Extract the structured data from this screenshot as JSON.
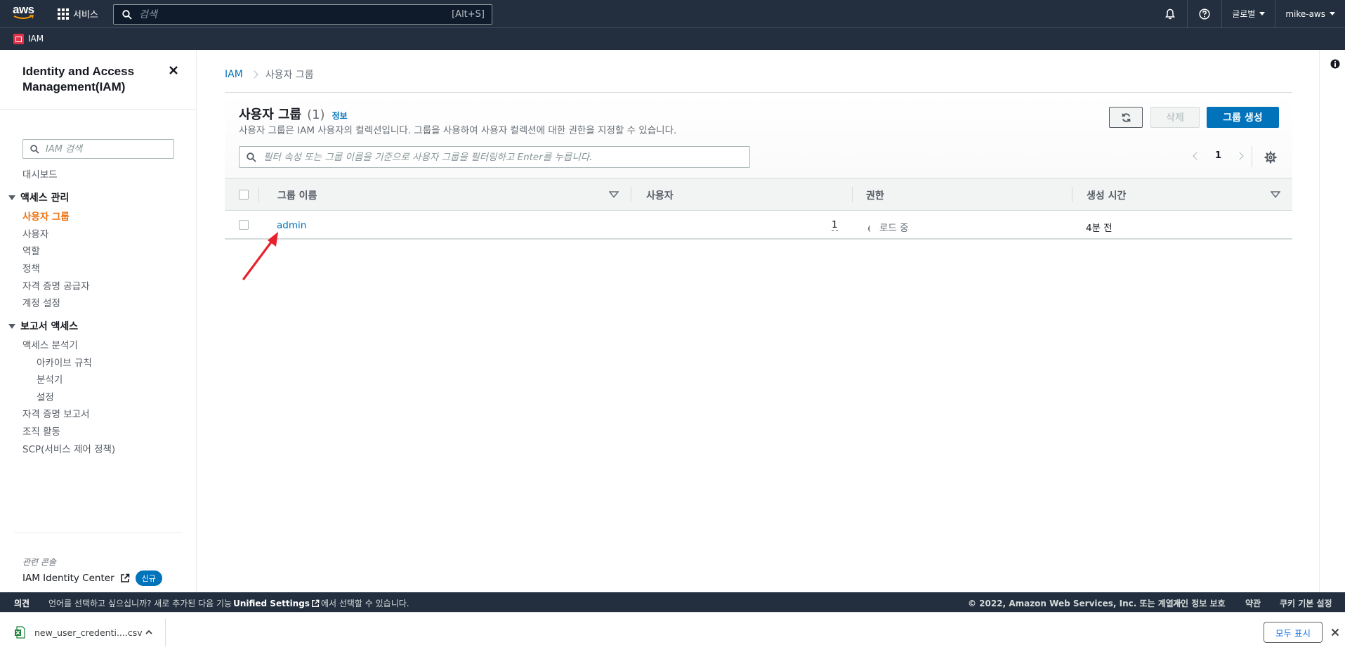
{
  "topnav": {
    "logo_text": "aws",
    "services_label": "서비스",
    "search_placeholder": "검색",
    "search_shortcut": "[Alt+S]",
    "region_label": "글로벌",
    "account_label": "mike-aws",
    "icons": [
      "bell-icon",
      "help-icon"
    ]
  },
  "subnav": {
    "service_name": "IAM"
  },
  "sidebar": {
    "title": "Identity and Access Management(IAM)",
    "search_placeholder": "IAM 검색",
    "dashboard": "대시보드",
    "sections": [
      {
        "label": "액세스 관리",
        "items": [
          "사용자 그룹",
          "사용자",
          "역할",
          "정책",
          "자격 증명 공급자",
          "계정 설정"
        ],
        "active_index": 0
      },
      {
        "label": "보고서 액세스",
        "items": [
          "액세스 분석기",
          "아카이브 규칙",
          "분석기",
          "설정",
          "자격 증명 보고서",
          "조직 활동",
          "SCP(서비스 제어 정책)"
        ]
      }
    ],
    "related_label": "관련 콘솔",
    "identity_center": "IAM Identity Center",
    "new_badge": "신규"
  },
  "breadcrumb": {
    "root": "IAM",
    "current": "사용자 그룹"
  },
  "panel": {
    "title": "사용자 그룹",
    "count": "(1)",
    "info_link": "정보",
    "description": "사용자 그룹은 IAM 사용자의 컬렉션입니다. 그룹을 사용하여 사용자 컬렉션에 대한 권한을 지정할 수 있습니다.",
    "delete_label": "삭제",
    "create_label": "그룹 생성",
    "filter_placeholder": "필터 속성 또는 그룹 이름을 기준으로 사용자 그룹을 필터링하고 Enter를 누릅니다.",
    "page_number": "1"
  },
  "table": {
    "columns": [
      "그룹 이름",
      "사용자",
      "권한",
      "생성 시간"
    ],
    "rows": [
      {
        "name": "admin",
        "users": "1",
        "permissions": "로드 중",
        "created": "4분 전"
      }
    ]
  },
  "footer": {
    "feedback": "의견",
    "language_text": "언어를 선택하고 싶으십니까? 새로 추가된 다음 기능",
    "unified_settings": "Unified Settings",
    "language_text_after": "에서 선택할 수 있습니다.",
    "copyright": "© 2022, Amazon Web Services, Inc. 또는 계열사.",
    "links": [
      "개인 정보 보호",
      "약관",
      "쿠키 기본 설정"
    ]
  },
  "download_bar": {
    "file_name": "new_user_credenti....csv",
    "show_all": "모두 표시"
  },
  "colors": {
    "nav_bg": "#232f3e",
    "link": "#0073bb",
    "active_nav": "#ec7211",
    "primary_button": "#0073bb",
    "annotation_arrow": "#e8212c"
  }
}
